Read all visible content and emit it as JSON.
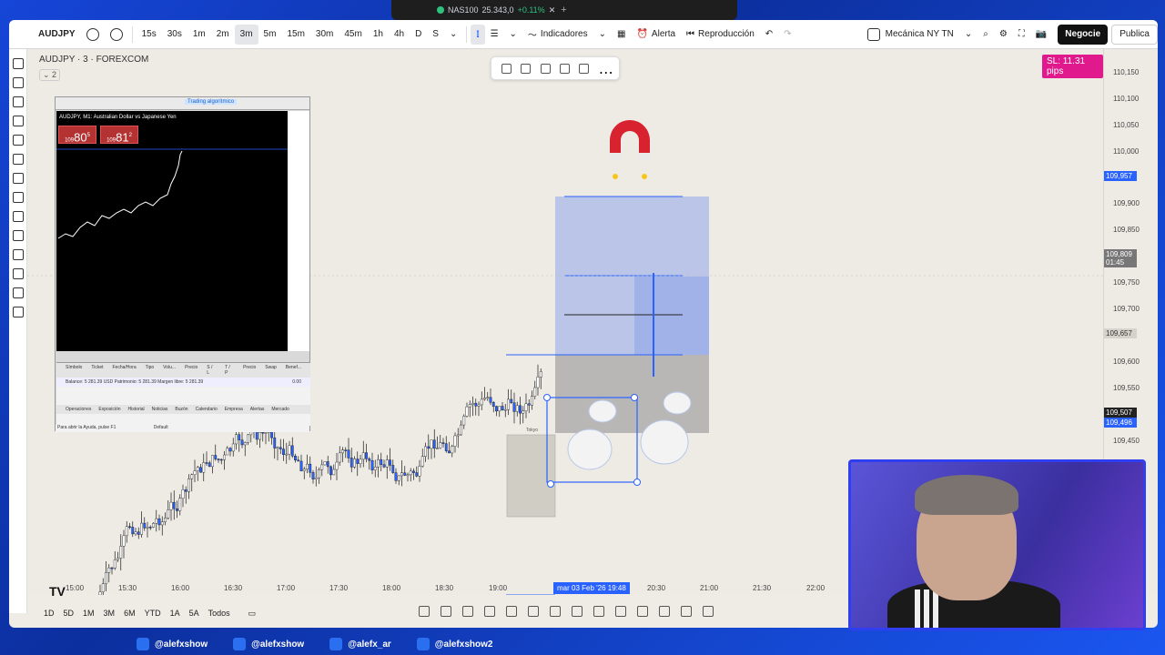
{
  "browser_tab": {
    "symbol": "NAS100",
    "price": "25.343,0",
    "change": "+0.11%"
  },
  "toolbar": {
    "symbol": "AUDJPY",
    "timeframes": [
      "15s",
      "30s",
      "1m",
      "2m",
      "3m",
      "5m",
      "15m",
      "30m",
      "45m",
      "1h",
      "4h",
      "D",
      "S"
    ],
    "active_timeframe": "3m",
    "indicators_label": "Indicadores",
    "alert_label": "Alerta",
    "replay_label": "Reproducción",
    "layout_name": "Mecánica NY TN",
    "trade_label": "Negocie",
    "publish_label": "Publica"
  },
  "chart": {
    "title": "AUDJPY · 3 · FOREXCOM",
    "indicator_count": "2",
    "sl_badge": "SL: 11.31 pips",
    "price_labels": [
      "110,150",
      "110,100",
      "110,050",
      "110,000",
      "109,957",
      "109,900",
      "109,850",
      "109,809",
      "109,750",
      "109,700",
      "109,657",
      "109,600",
      "109,550",
      "109,507",
      "109,496",
      "109,450"
    ],
    "badge_top": "109,957",
    "badge_current": "109,809",
    "badge_timer": "01:45",
    "badge_mid": "109,657",
    "badge_low1": "109,507",
    "badge_low2": "109,496",
    "time_labels": [
      "15:00",
      "15:30",
      "16:00",
      "16:30",
      "17:00",
      "17:30",
      "18:00",
      "18:30",
      "19:00",
      "20:30",
      "21:00",
      "21:30",
      "22:00"
    ],
    "time_cursor": "mar 03 Feb '26  19:48",
    "session_label": "Tokyo"
  },
  "bottombar": {
    "ranges": [
      "1D",
      "5D",
      "1M",
      "3M",
      "6M",
      "YTD",
      "1A",
      "5A",
      "Todos"
    ]
  },
  "mt_panel": {
    "algo_label": "Trading algorítmico",
    "pair_info": "AUDJPY, M1: Australian Dollar vs Japanese Yen",
    "bid": "80",
    "bid_prefix": "109",
    "bid_sup": "5",
    "ask": "81",
    "ask_prefix": "109",
    "ask_sup": "2",
    "terminal_headers": [
      "Símbolo",
      "Ticket",
      "Fecha/Hora",
      "Tipo",
      "Volu...",
      "Precio",
      "S / L",
      "T / P",
      "Precio",
      "Swap",
      "Benef..."
    ],
    "balance_line": "Balance: 5 281.39 USD  Patrimonio: 5 281.39  Margen libre: 5 281.39",
    "profit_value": "0.00",
    "terminal_tabs": [
      "Operaciones",
      "Exposición",
      "Historial",
      "Noticias",
      "Buzón",
      "Calendario",
      "Empresa",
      "Alertas",
      "Mercado"
    ],
    "status_left": "Para abrir la Ayuda, pulse F1",
    "status_mid": "Default"
  },
  "footer": {
    "socials": [
      {
        "icon": "tiktok-icon",
        "handle": "@alefxshow"
      },
      {
        "icon": "x-icon",
        "handle": "@alefxshow"
      },
      {
        "icon": "instagram-icon",
        "handle": "@alefx_ar"
      },
      {
        "icon": "youtube-icon",
        "handle": "@alefxshow2"
      }
    ]
  },
  "colors": {
    "accent": "#2962ff",
    "sl_badge": "#e01a8c",
    "tp_zone": "#a9b8e8",
    "sl_zone": "#a6a6a6",
    "frame": "#1646d8"
  }
}
